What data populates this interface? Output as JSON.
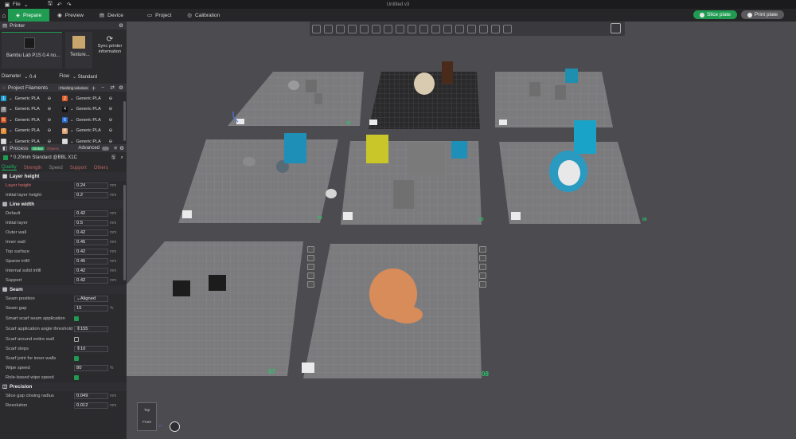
{
  "window": {
    "title": "Untitled v3",
    "file_menu": "File"
  },
  "nav": {
    "tabs": [
      {
        "label": "Prepare",
        "icon": "cube-icon",
        "active": true
      },
      {
        "label": "Preview",
        "icon": "eye-icon"
      },
      {
        "label": "Device",
        "icon": "printer-icon"
      },
      {
        "label": "Project",
        "icon": "folder-icon"
      },
      {
        "label": "Calibration",
        "icon": "gauge-icon"
      }
    ],
    "slice_button": "Slice plate",
    "print_button": "Print plate",
    "accent": "#1f9b52"
  },
  "printer": {
    "section": "Printer",
    "name": "Bambu Lab P1S 0.4 no...",
    "plate": "Texture...",
    "sync_label": "Sync printer information",
    "diameter_label": "Diameter",
    "diameter_value": "0.4",
    "flow_label": "Flow",
    "flow_value": "Standard"
  },
  "filaments": {
    "section": "Project Filaments",
    "flushing": "Flushing volumes",
    "items": [
      {
        "num": "1",
        "name": "Generic PLA",
        "color": "#1aa3d8"
      },
      {
        "num": "2",
        "name": "Generic PLA",
        "color": "#e0602a"
      },
      {
        "num": "3",
        "name": "Generic PLA",
        "color": "#8a8a8a"
      },
      {
        "num": "4",
        "name": "Generic PLA",
        "color": "#111111"
      },
      {
        "num": "5",
        "name": "Generic PLA",
        "color": "#d95a2a"
      },
      {
        "num": "6",
        "name": "Generic PLA",
        "color": "#2a6fd1"
      },
      {
        "num": "7",
        "name": "Generic PLA",
        "color": "#e8903a"
      },
      {
        "num": "8",
        "name": "Generic PLA",
        "color": "#e0a878"
      },
      {
        "num": "9",
        "name": "Generic PLA",
        "color": "#cfcfcf"
      },
      {
        "num": "10",
        "name": "Generic PLA",
        "color": "#cfcfcf"
      }
    ]
  },
  "process": {
    "section": "Process",
    "global": "Global",
    "objects": "Objects",
    "advanced": "Advanced",
    "preset": "* 0.20mm Standard @BBL X1C",
    "tabs": [
      "Quality",
      "Strength",
      "Speed",
      "Support",
      "Others"
    ],
    "groups": {
      "layer_height": "Layer height",
      "line_width": "Line width",
      "seam": "Seam",
      "precision": "Precision"
    },
    "layer": [
      {
        "label": "Layer height",
        "value": "0.24",
        "unit": "mm"
      },
      {
        "label": "Initial layer height",
        "value": "0.2",
        "unit": "mm"
      }
    ],
    "lines": [
      {
        "label": "Default",
        "value": "0.42",
        "unit": "mm"
      },
      {
        "label": "Initial layer",
        "value": "0.5",
        "unit": "mm"
      },
      {
        "label": "Outer wall",
        "value": "0.42",
        "unit": "mm"
      },
      {
        "label": "Inner wall",
        "value": "0.45",
        "unit": "mm"
      },
      {
        "label": "Top surface",
        "value": "0.42",
        "unit": "mm"
      },
      {
        "label": "Sparse infill",
        "value": "0.45",
        "unit": "mm"
      },
      {
        "label": "Internal solid infill",
        "value": "0.42",
        "unit": "mm"
      },
      {
        "label": "Support",
        "value": "0.42",
        "unit": "mm"
      }
    ],
    "seam": {
      "position_label": "Seam position",
      "position_value": "Aligned",
      "gap_label": "Seam gap",
      "gap_value": "15",
      "gap_unit": "%",
      "smart_label": "Smart scarf seam application",
      "angle_label": "Scarf application angle threshold",
      "angle_value": "155",
      "entire_label": "Scarf around entire wall",
      "steps_label": "Scarf steps",
      "steps_value": "10",
      "inner_label": "Scarf joint for inner walls",
      "speed_label": "Wipe speed",
      "speed_value": "80",
      "speed_unit": "%",
      "role_label": "Role-based wipe speed"
    },
    "precision": {
      "gap_label": "Slice gap closing radius",
      "gap_value": "0.049",
      "gap_unit": "mm",
      "res_label": "Resolution",
      "res_value": "0.012",
      "res_unit": "mm"
    }
  },
  "viewport": {
    "plate_numbers": [
      "02",
      "04",
      "05",
      "06",
      "07",
      "08"
    ],
    "view_cube_label": "Top",
    "view_cube_sub": "Front"
  }
}
